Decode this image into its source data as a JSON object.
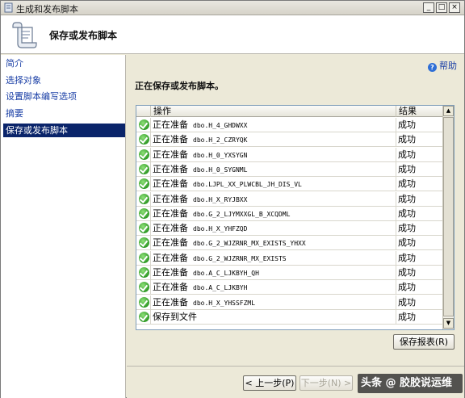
{
  "window": {
    "title": "生成和发布脚本",
    "min_glyph": "_",
    "max_glyph": "□",
    "close_glyph": "×"
  },
  "header": {
    "title": "保存或发布脚本"
  },
  "sidebar": {
    "items": [
      {
        "label": "简介"
      },
      {
        "label": "选择对象"
      },
      {
        "label": "设置脚本编写选项"
      },
      {
        "label": "摘要"
      },
      {
        "label": "保存或发布脚本",
        "active": true
      }
    ]
  },
  "main": {
    "help": "帮助",
    "status": "正在保存或发布脚本。",
    "columns": {
      "action": "操作",
      "result": "结果"
    },
    "rows": [
      {
        "action": "正在准备",
        "object": "dbo.H_4_GHDWXX",
        "result": "成功"
      },
      {
        "action": "正在准备",
        "object": "dbo.H_2_CZRYQK",
        "result": "成功"
      },
      {
        "action": "正在准备",
        "object": "dbo.H_0_YXSYGN",
        "result": "成功"
      },
      {
        "action": "正在准备",
        "object": "dbo.H_0_SYGNML",
        "result": "成功"
      },
      {
        "action": "正在准备",
        "object": "dbo.LJPL_XX_PLWCBL_JH_DIS_VL",
        "result": "成功"
      },
      {
        "action": "正在准备",
        "object": "dbo.H_X_RYJBXX",
        "result": "成功"
      },
      {
        "action": "正在准备",
        "object": "dbo.G_2_LJYMXXGL_B_XCQDML",
        "result": "成功"
      },
      {
        "action": "正在准备",
        "object": "dbo.H_X_YHFZQD",
        "result": "成功"
      },
      {
        "action": "正在准备",
        "object": "dbo.G_2_WJZRNR_MX_EXISTS_YHXX",
        "result": "成功"
      },
      {
        "action": "正在准备",
        "object": "dbo.G_2_WJZRNR_MX_EXISTS",
        "result": "成功"
      },
      {
        "action": "正在准备",
        "object": "dbo.A_C_LJKBYH_QH",
        "result": "成功"
      },
      {
        "action": "正在准备",
        "object": "dbo.A_C_LJKBYH",
        "result": "成功"
      },
      {
        "action": "正在准备",
        "object": "dbo.H_X_YHSSFZML",
        "result": "成功"
      },
      {
        "action": "保存到文件",
        "object": "",
        "result": "成功"
      }
    ],
    "save_report": "保存报表(R)"
  },
  "footer": {
    "prev": "< 上一步(P)",
    "next": "下一步(N) >",
    "watermark": "头条 @ 胶胶说运维"
  },
  "colors": {
    "accent": "#0a246a",
    "link": "#1a3fa6",
    "success": "#2f9a25"
  }
}
